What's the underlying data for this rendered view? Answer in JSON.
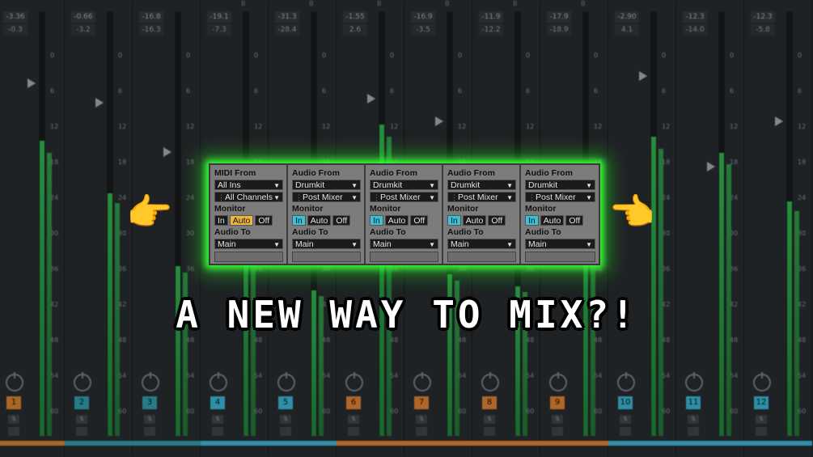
{
  "headline": "A NEW WAY TO MIX?!",
  "mixer_strips": [
    {
      "vol": "-3.36",
      "peak": "-0.3",
      "num": "1",
      "color": "#c8782e",
      "solo": "S",
      "mark": "",
      "meter": 0.73,
      "fader": 0.9
    },
    {
      "vol": "-0.66",
      "peak": "-3.2",
      "num": "2",
      "color": "#2e8f9e",
      "solo": "S",
      "mark": "",
      "meter": 0.6,
      "fader": 0.85
    },
    {
      "vol": "-16.8",
      "peak": "-16.3",
      "num": "3",
      "color": "#2e8f9e",
      "solo": "S",
      "mark": "",
      "meter": 0.42,
      "fader": 0.72
    },
    {
      "vol": "-19.1",
      "peak": "-7.3",
      "num": "4",
      "color": "#36a8c4",
      "solo": "S",
      "mark": "B",
      "meter": 0.65,
      "fader": 0.62
    },
    {
      "vol": "-31.3",
      "peak": "-28.4",
      "num": "5",
      "color": "#36a8c4",
      "solo": "S",
      "mark": "B",
      "meter": 0.36,
      "fader": 0.55
    },
    {
      "vol": "-1.55",
      "peak": "2.6",
      "num": "6",
      "color": "#d07830",
      "solo": "S",
      "mark": "B",
      "meter": 0.77,
      "fader": 0.86
    },
    {
      "vol": "-16.9",
      "peak": "-3.5",
      "num": "7",
      "color": "#d07830",
      "solo": "S",
      "mark": "B",
      "meter": 0.4,
      "fader": 0.8
    },
    {
      "vol": "-11.9",
      "peak": "-12.2",
      "num": "8",
      "color": "#d07830",
      "solo": "S",
      "mark": "B",
      "meter": 0.37,
      "fader": 0.67
    },
    {
      "vol": "-17.9",
      "peak": "-18.9",
      "num": "9",
      "color": "#d07830",
      "solo": "S",
      "mark": "B",
      "meter": 0.55,
      "fader": 0.65
    },
    {
      "vol": "-2.90",
      "peak": "4.1",
      "num": "10",
      "color": "#36a8c4",
      "solo": "S",
      "mark": "",
      "meter": 0.74,
      "fader": 0.92
    },
    {
      "vol": "-12.3",
      "peak": "-14.0",
      "num": "11",
      "color": "#36a8c4",
      "solo": "S",
      "mark": "",
      "meter": 0.7,
      "fader": 0.68
    },
    {
      "vol": "-12.3",
      "peak": "-5.8",
      "num": "12",
      "color": "#36a8c4",
      "solo": "S",
      "mark": "",
      "meter": 0.58,
      "fader": 0.8
    }
  ],
  "scale_labels": [
    "0",
    "6",
    "12",
    "18",
    "24",
    "30",
    "36",
    "42",
    "48",
    "54",
    "60"
  ],
  "io_columns": [
    {
      "from_label": "MIDI From",
      "from_value": "All Ins",
      "sub_value": "All Channels",
      "monitor_label": "Monitor",
      "mon_in": "In",
      "mon_auto": "Auto",
      "mon_off": "Off",
      "active": "auto",
      "to_label": "Audio To",
      "to_value": "Main"
    },
    {
      "from_label": "Audio From",
      "from_value": "Drumkit",
      "sub_value": "Post Mixer",
      "monitor_label": "Monitor",
      "mon_in": "In",
      "mon_auto": "Auto",
      "mon_off": "Off",
      "active": "in",
      "to_label": "Audio To",
      "to_value": "Main"
    },
    {
      "from_label": "Audio From",
      "from_value": "Drumkit",
      "sub_value": "Post Mixer",
      "monitor_label": "Monitor",
      "mon_in": "In",
      "mon_auto": "Auto",
      "mon_off": "Off",
      "active": "in",
      "to_label": "Audio To",
      "to_value": "Main"
    },
    {
      "from_label": "Audio From",
      "from_value": "Drumkit",
      "sub_value": "Post Mixer",
      "monitor_label": "Monitor",
      "mon_in": "In",
      "mon_auto": "Auto",
      "mon_off": "Off",
      "active": "in",
      "to_label": "Audio To",
      "to_value": "Main"
    },
    {
      "from_label": "Audio From",
      "from_value": "Drumkit",
      "sub_value": "Post Mixer",
      "monitor_label": "Monitor",
      "mon_in": "In",
      "mon_auto": "Auto",
      "mon_off": "Off",
      "active": "in",
      "to_label": "Audio To",
      "to_value": "Main"
    }
  ],
  "colors": {
    "glow": "#38ff38",
    "auto_active": "#f0b43c",
    "in_active": "#36c4d4",
    "meter": "#2ea84a"
  },
  "icons": {
    "left_hand": "pointing-right-hand-icon",
    "right_hand": "pointing-left-hand-icon"
  },
  "hands": {
    "left": "👉",
    "right": "👉"
  }
}
